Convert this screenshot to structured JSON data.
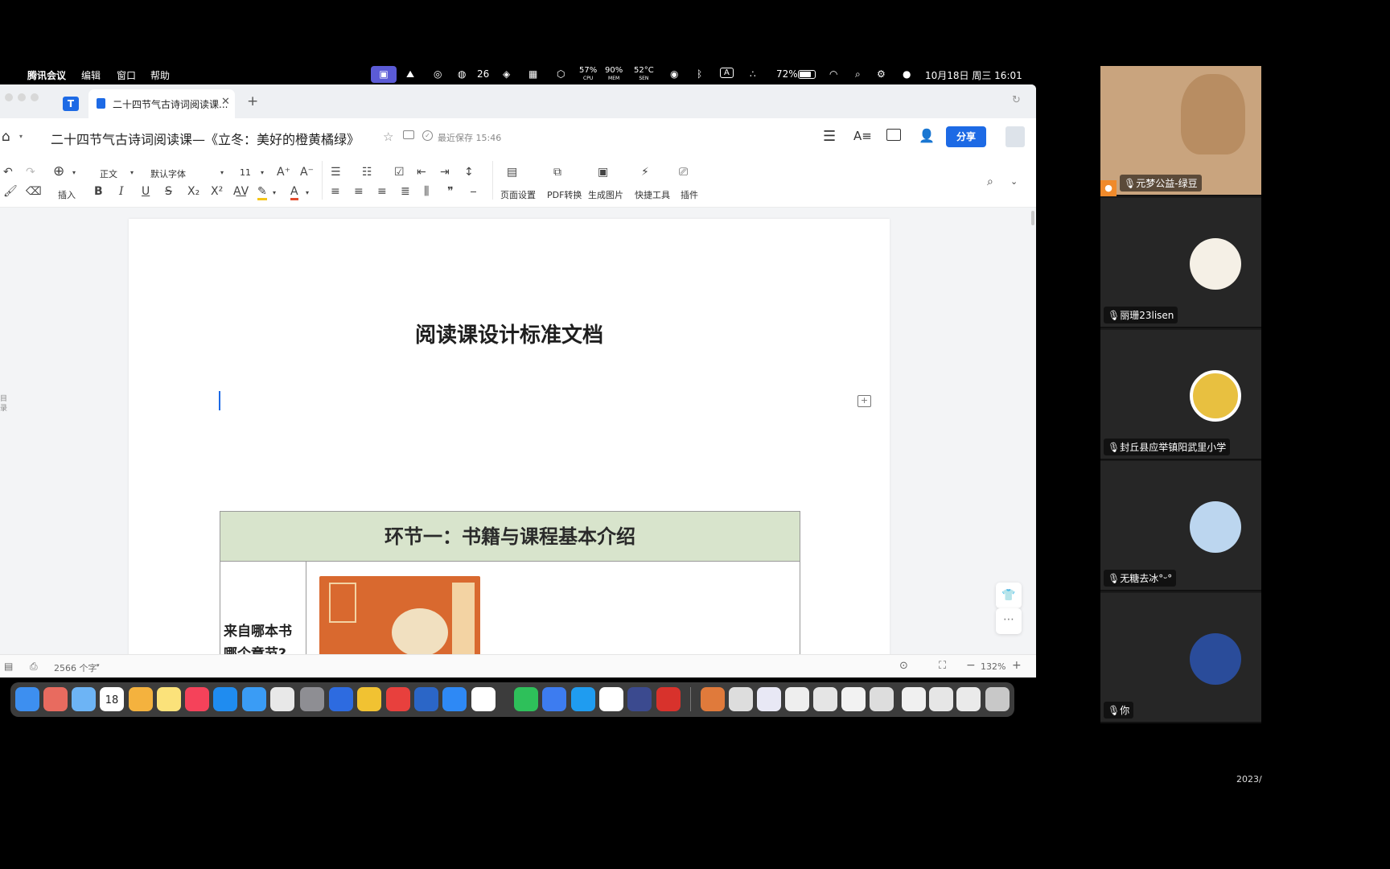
{
  "menubar": {
    "app": "腾讯会议",
    "edit": "编辑",
    "window": "窗口",
    "help": "帮助",
    "wechat_count": "26",
    "cpu_value": "57%",
    "cpu_label": "CPU",
    "mem_value": "90%",
    "mem_label": "MEM",
    "temp_value": "52°C",
    "temp_label": "SEN",
    "input_method": "A",
    "battery": "72%",
    "datetime": "10月18日 周三  16:01"
  },
  "tab": {
    "title": "二十四节气古诗词阅读课...",
    "new_tab": "+"
  },
  "doc": {
    "title": "二十四节气古诗词阅读课—《立冬：美好的橙黄橘绿》",
    "saved": "最近保存 15:46",
    "share": "分享",
    "heading": "阅读课设计标准文档",
    "table_header": "环节一：书籍与课程基本介绍",
    "row_label_1": "来自哪本书",
    "row_label_2": "哪个章节?"
  },
  "toolbar": {
    "style": "正文",
    "font": "默认字体",
    "size": "11",
    "insert": "插入",
    "page_setup": "页面设置",
    "pdf": "PDF转换",
    "gen_image": "生成图片",
    "quick_tools": "快捷工具",
    "plugins": "插件"
  },
  "status": {
    "word_count": "2566 个字",
    "zoom": "132%"
  },
  "side_tab": "目录",
  "participants": [
    {
      "name": "元梦公益-绿豆"
    },
    {
      "name": "丽珊23lisen"
    },
    {
      "name": "封丘县应举镇阳武里小学"
    },
    {
      "name": "无糖去冰°ᵕ°"
    },
    {
      "name": "你"
    }
  ],
  "corner_text": "2023/",
  "dock_calendar": "18",
  "colors": {
    "accent": "#1d6ae5",
    "table_header_bg": "#d8e4cc",
    "book_orange": "#d9692f"
  }
}
